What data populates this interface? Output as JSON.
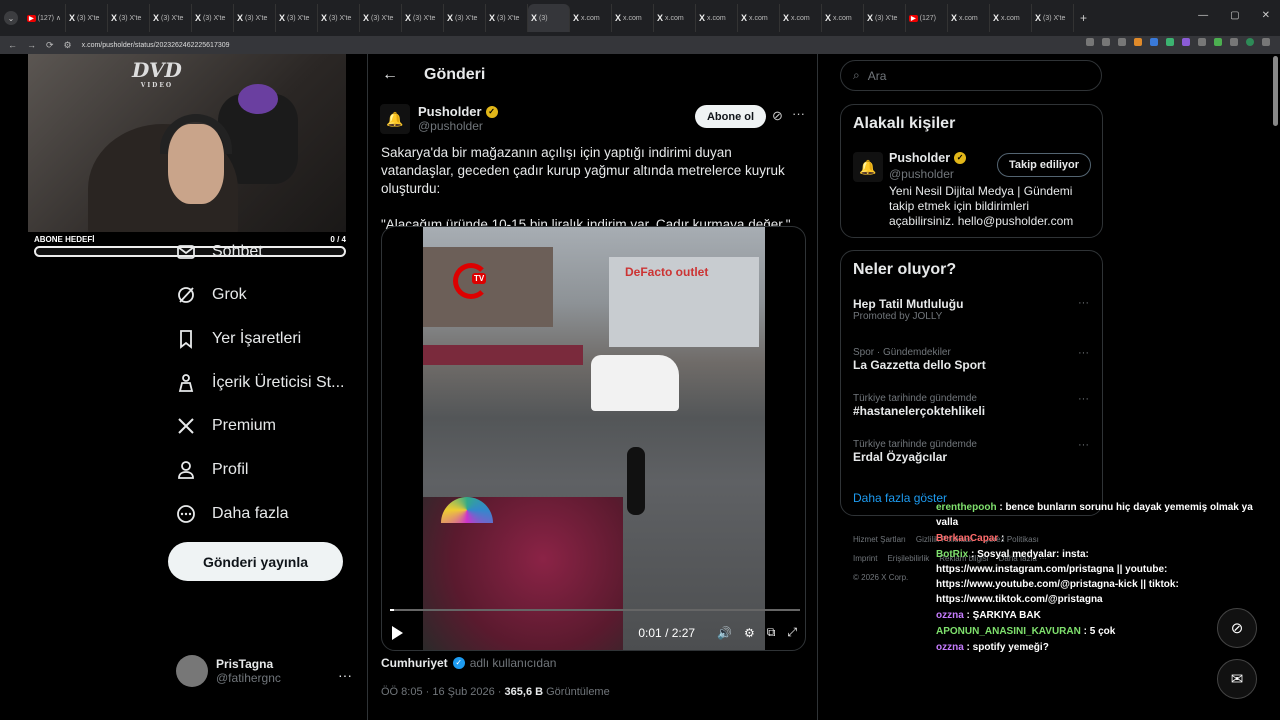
{
  "browser": {
    "tabs": [
      {
        "fav": "▶",
        "label": "(127) ∧",
        "yt": true
      },
      {
        "fav": "X",
        "label": "(3) X'te"
      },
      {
        "fav": "X",
        "label": "(3) X'te"
      },
      {
        "fav": "X",
        "label": "(3) X'te"
      },
      {
        "fav": "X",
        "label": "(3) X'te"
      },
      {
        "fav": "X",
        "label": "(3) X'te"
      },
      {
        "fav": "X",
        "label": "(3) X'te"
      },
      {
        "fav": "X",
        "label": "(3) X'te"
      },
      {
        "fav": "X",
        "label": "(3) X'te"
      },
      {
        "fav": "X",
        "label": "(3) X'te"
      },
      {
        "fav": "X",
        "label": "(3) X'te"
      },
      {
        "fav": "X",
        "label": "(3) X'te"
      },
      {
        "fav": "X",
        "label": "(3)",
        "active": true
      },
      {
        "fav": "X",
        "label": "x.com"
      },
      {
        "fav": "X",
        "label": "x.com"
      },
      {
        "fav": "X",
        "label": "x.com"
      },
      {
        "fav": "X",
        "label": "x.com"
      },
      {
        "fav": "X",
        "label": "x.com"
      },
      {
        "fav": "X",
        "label": "x.com"
      },
      {
        "fav": "X",
        "label": "x.com"
      },
      {
        "fav": "X",
        "label": "(3) X'te"
      },
      {
        "fav": "▶",
        "label": "(127)",
        "yt": true
      },
      {
        "fav": "X",
        "label": "x.com"
      },
      {
        "fav": "X",
        "label": "x.com"
      },
      {
        "fav": "X",
        "label": "(3) X'te"
      }
    ],
    "url": "x.com/pusholder/status/2023262462225617309"
  },
  "stream": {
    "logo_text": "DVD",
    "logo_sub": "VIDEO",
    "goal_label": "ABONE HEDEFİ",
    "goal_count": "0 / 4",
    "goal_progress": 0
  },
  "sidebar": {
    "items": [
      {
        "label": "Sohbet",
        "icon": "mail-icon",
        "name": "nav-sohbet"
      },
      {
        "label": "Grok",
        "icon": "grok-icon",
        "name": "nav-grok"
      },
      {
        "label": "Yer İşaretleri",
        "icon": "bookmark-icon",
        "name": "nav-bookmarks"
      },
      {
        "label": "İçerik Üreticisi St...",
        "icon": "creator-icon",
        "name": "nav-creator-studio"
      },
      {
        "label": "Premium",
        "icon": "x-logo-icon",
        "name": "nav-premium"
      },
      {
        "label": "Profil",
        "icon": "profile-icon",
        "name": "nav-profile"
      },
      {
        "label": "Daha fazla",
        "icon": "more-circle-icon",
        "name": "nav-more"
      }
    ],
    "post_button": "Gönderi yayınla",
    "account": {
      "name": "PrisTagna",
      "handle": "@fatihergnc"
    }
  },
  "post": {
    "header": "Gönderi",
    "author_name": "Pusholder",
    "author_handle": "@pusholder",
    "follow_label": "Abone ol",
    "text1": "Sakarya'da bir mağazanın açılışı için yaptığı indirimi duyan vatandaşlar, geceden çadır kurup yağmur altında metrelerce kuyruk oluşturdu:",
    "text2": "\"Alacağım üründe 10-15 bin liralık indirim var. Çadır kurmaya değer.\"",
    "video": {
      "overlay_tv": "TV",
      "store_sign": "DeFacto outlet",
      "time": "0:01 / 2:27",
      "progress": 0.01
    },
    "source_name": "Cumhuriyet",
    "source_suffix": "adlı kullanıcıdan",
    "timestamp": "ÖÖ 8:05 · 16 Şub 2026 ·",
    "views": "365,6 B",
    "views_label": "Görüntüleme"
  },
  "right": {
    "search_placeholder": "Ara",
    "related_title": "Alakalı kişiler",
    "related": {
      "name": "Pusholder",
      "handle": "@pusholder",
      "bio": "Yeni Nesil Dijital Medya | Gündemi takip etmek için bildirimleri açabilirsiniz. hello@pusholder.com",
      "button": "Takip ediliyor"
    },
    "trends_title": "Neler oluyor?",
    "trends": [
      {
        "ctx": "",
        "name": "Hep Tatil Mutluluğu",
        "promo": "Promoted by JOLLY"
      },
      {
        "ctx": "Spor · Gündemdekiler",
        "name": "La Gazzetta dello Sport"
      },
      {
        "ctx": "Türkiye tarihinde gündemde",
        "name": "#hastanelerçoktehlikeli"
      },
      {
        "ctx": "Türkiye tarihinde gündemde",
        "name": "Erdal Özyağcılar"
      }
    ],
    "show_more": "Daha fazla göster",
    "footer": [
      "Hizmet Şartları",
      "Gizlilik Politikası",
      "Çerez Politikası",
      "Imprint",
      "Erişilebilirlik",
      "Reklam bilgisi",
      "Daha fazla ···",
      "© 2026 X Corp."
    ]
  },
  "chat": [
    {
      "user": "erenthepooh",
      "cls": "",
      "msg": " : bence bunların sorunu hiç dayak yememiş olmak ya valla"
    },
    {
      "user": "BerkanCapar",
      "cls": "r",
      "msg": " :"
    },
    {
      "user": "BotRix",
      "cls": "",
      "msg": " : Sosyal medyalar: insta: https://www.instagram.com/pristagna || youtube: https://www.youtube.com/@pristagna-kick || tiktok: https://www.tiktok.com/@pristagna"
    },
    {
      "user": "ozzna",
      "cls": "p",
      "msg": " : ŞARKIYA BAK"
    },
    {
      "user": "APONUN_ANASINI_KAVURAN",
      "cls": "",
      "msg": " : 5 çok"
    },
    {
      "user": "ozzna",
      "cls": "p",
      "msg": " : spotify yemeği?"
    }
  ]
}
